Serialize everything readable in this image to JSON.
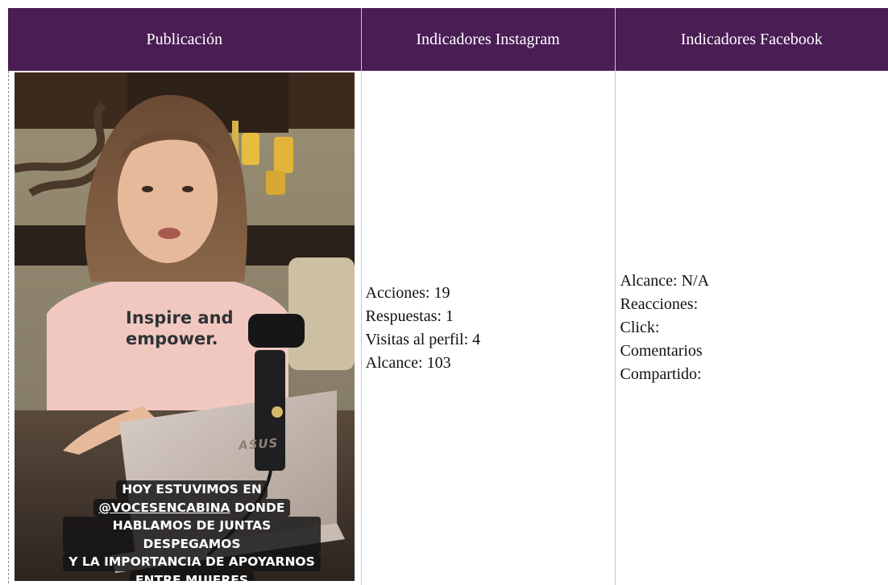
{
  "table": {
    "headers": {
      "publication": "Publicación",
      "instagram": "Indicadores Instagram",
      "facebook": "Indicadores Facebook"
    },
    "row": {
      "image": {
        "alt": "Publicación de Instagram: mujer frente a una laptop con cámara web",
        "shirt_line1": "Inspire and",
        "shirt_line2": "empower.",
        "laptop_brand": "ASUS",
        "caption_line1": "HOY ESTUVIMOS EN",
        "caption_mention": "@VOCESENCABINA",
        "caption_line2_rest": " DONDE",
        "caption_line3": "HABLAMOS DE JUNTAS DESPEGAMOS",
        "caption_line4": "Y LA IMPORTANCIA DE APOYARNOS",
        "caption_line5": "ENTRE MUJERES"
      },
      "instagram": [
        "Acciones: 19",
        "Respuestas: 1",
        "Visitas al perfil: 4",
        "Alcance: 103"
      ],
      "facebook": [
        "Alcance: N/A",
        "Reacciones:",
        "Click:",
        "Comentarios",
        "Compartido:"
      ]
    }
  },
  "colors": {
    "header_bg": "#4a1d55",
    "header_text": "#ffffff",
    "border": "#c8c8c8"
  }
}
